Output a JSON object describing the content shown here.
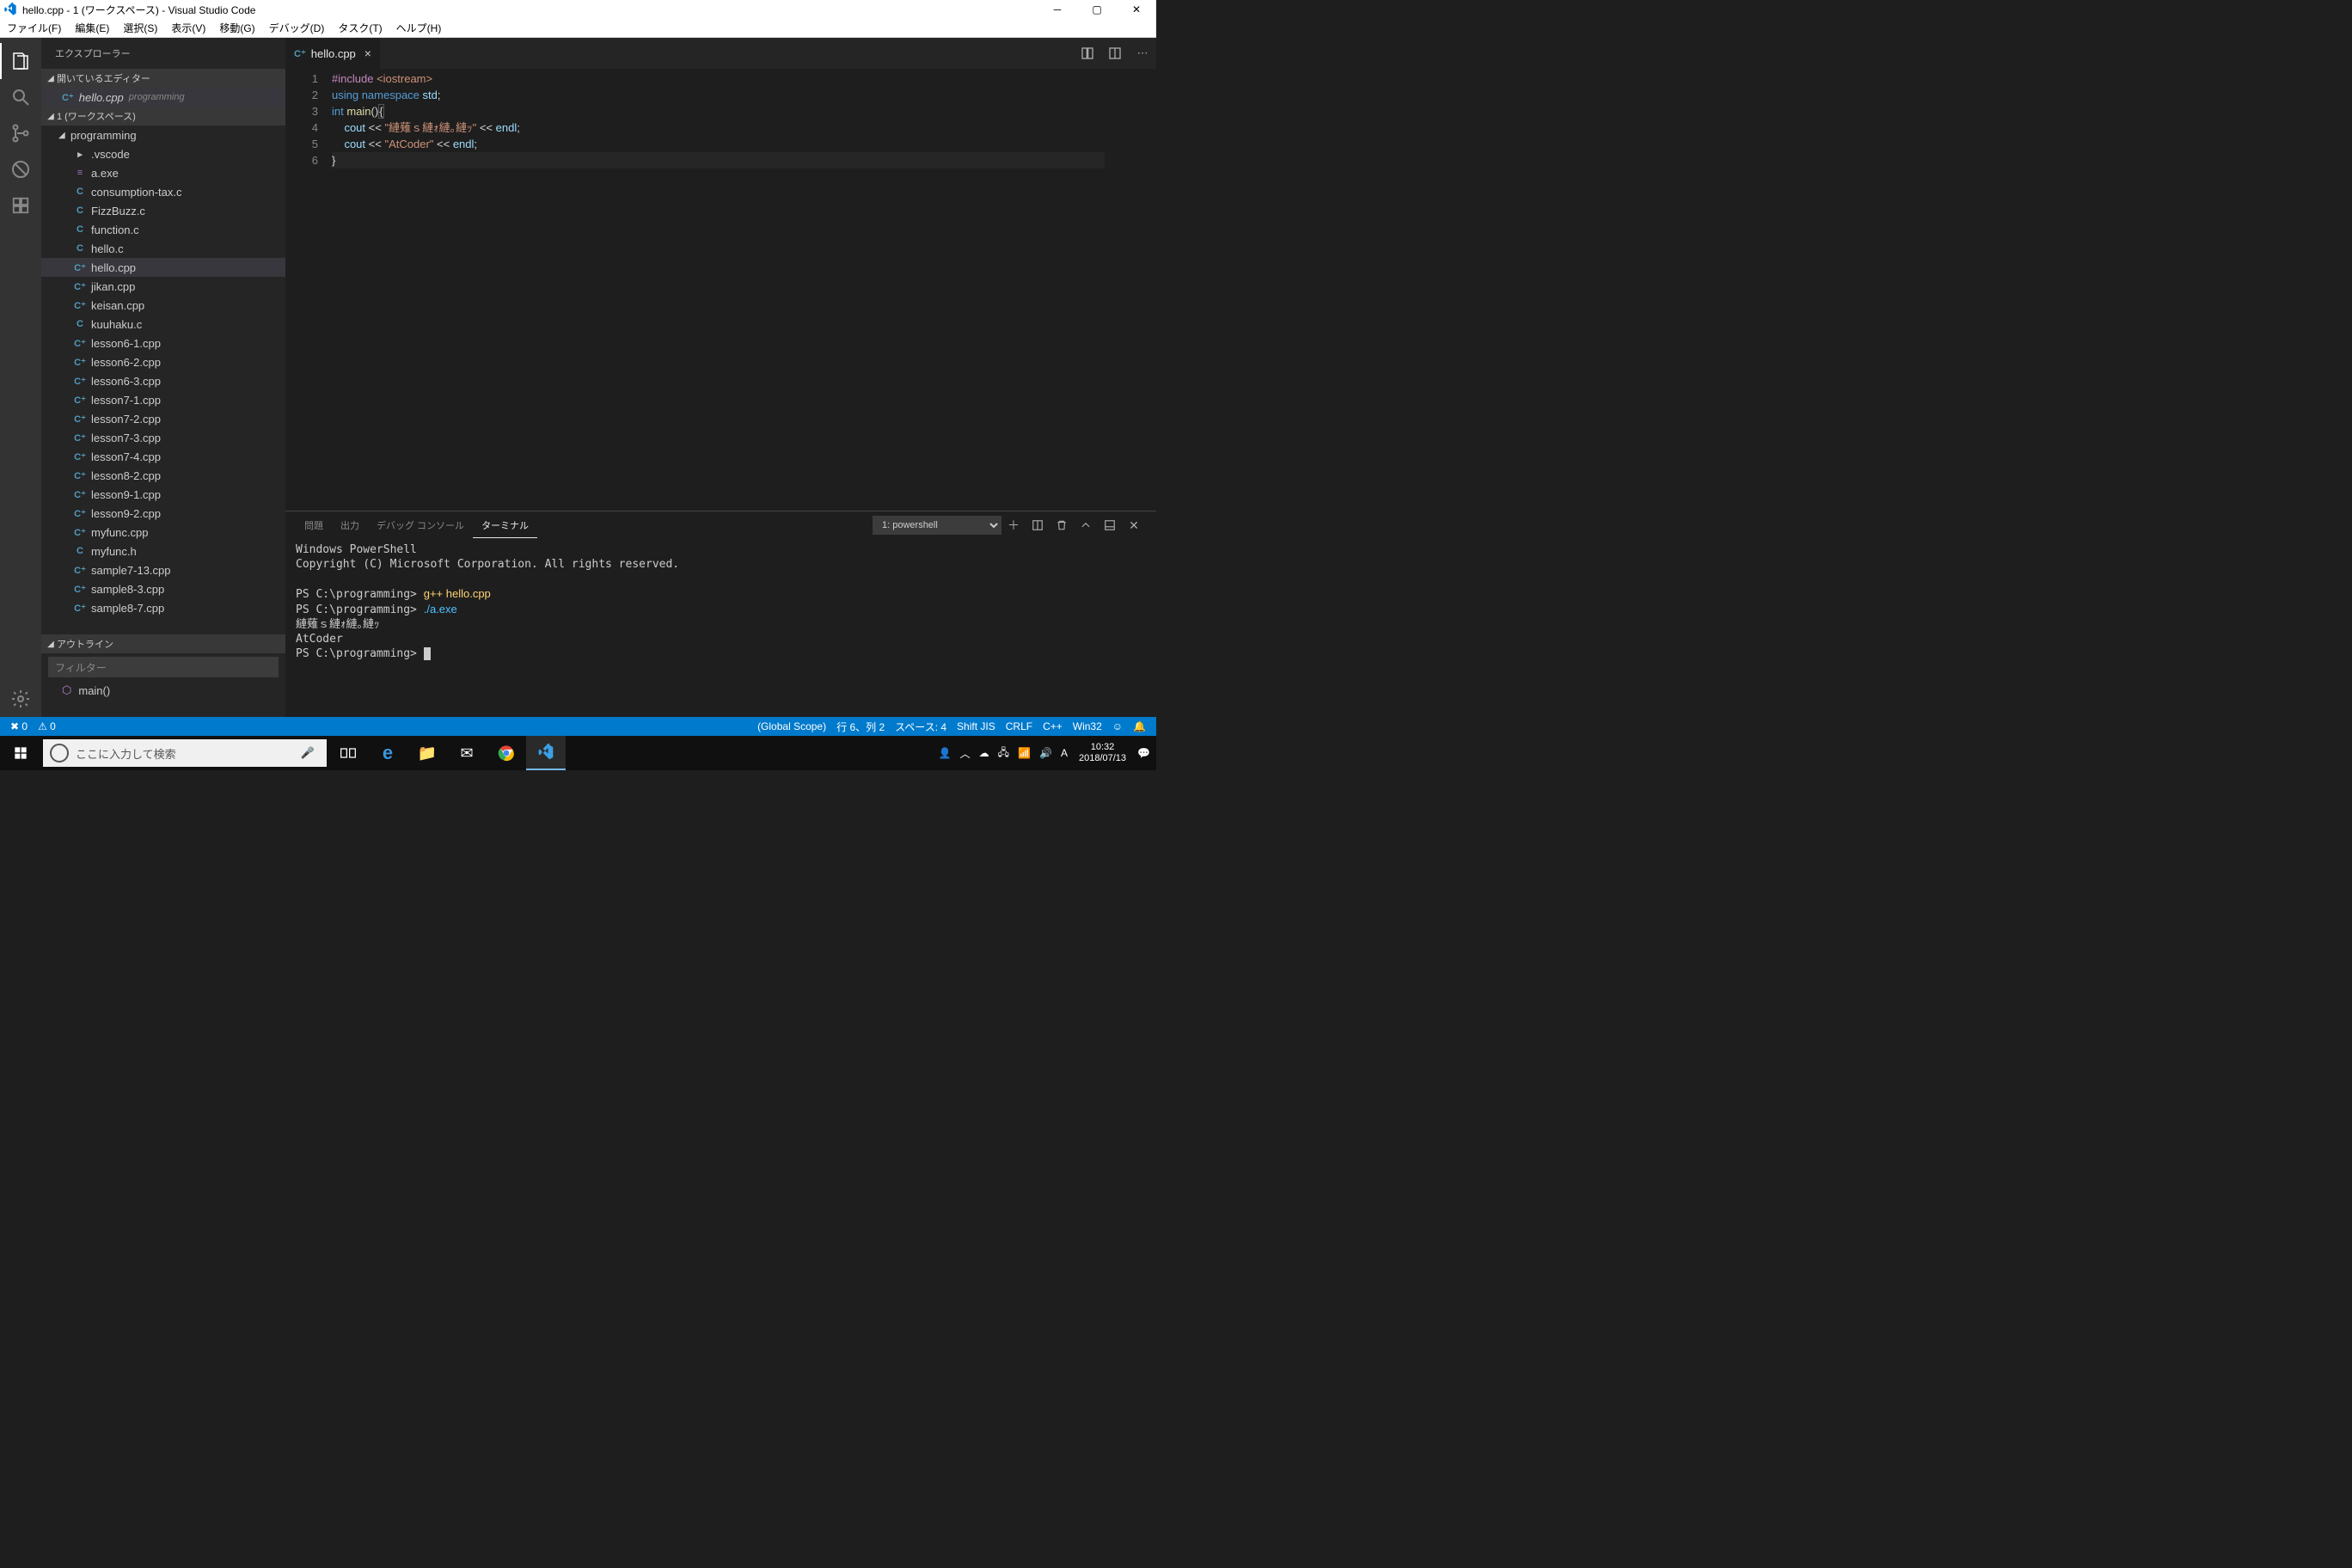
{
  "window": {
    "title": "hello.cpp - 1 (ワークスペース) - Visual Studio Code"
  },
  "menu": [
    "ファイル(F)",
    "編集(E)",
    "選択(S)",
    "表示(V)",
    "移動(G)",
    "デバッグ(D)",
    "タスク(T)",
    "ヘルプ(H)"
  ],
  "sidebar": {
    "title": "エクスプローラー",
    "openEditors": {
      "header": "開いているエディター",
      "items": [
        {
          "name": "hello.cpp",
          "dir": "programming",
          "icon": "C⁺"
        }
      ]
    },
    "workspace": {
      "header": "1 (ワークスペース)",
      "root": "programming",
      "files": [
        {
          "name": ".vscode",
          "icon": "▸",
          "cls": "ico-folder"
        },
        {
          "name": "a.exe",
          "icon": "≡",
          "cls": "ico-exe"
        },
        {
          "name": "consumption-tax.c",
          "icon": "C",
          "cls": "ico-c"
        },
        {
          "name": "FizzBuzz.c",
          "icon": "C",
          "cls": "ico-c"
        },
        {
          "name": "function.c",
          "icon": "C",
          "cls": "ico-c"
        },
        {
          "name": "hello.c",
          "icon": "C",
          "cls": "ico-c"
        },
        {
          "name": "hello.cpp",
          "icon": "C⁺",
          "cls": "ico-cpp",
          "selected": true
        },
        {
          "name": "jikan.cpp",
          "icon": "C⁺",
          "cls": "ico-cpp"
        },
        {
          "name": "keisan.cpp",
          "icon": "C⁺",
          "cls": "ico-cpp"
        },
        {
          "name": "kuuhaku.c",
          "icon": "C",
          "cls": "ico-c"
        },
        {
          "name": "lesson6-1.cpp",
          "icon": "C⁺",
          "cls": "ico-cpp"
        },
        {
          "name": "lesson6-2.cpp",
          "icon": "C⁺",
          "cls": "ico-cpp"
        },
        {
          "name": "lesson6-3.cpp",
          "icon": "C⁺",
          "cls": "ico-cpp"
        },
        {
          "name": "lesson7-1.cpp",
          "icon": "C⁺",
          "cls": "ico-cpp"
        },
        {
          "name": "lesson7-2.cpp",
          "icon": "C⁺",
          "cls": "ico-cpp"
        },
        {
          "name": "lesson7-3.cpp",
          "icon": "C⁺",
          "cls": "ico-cpp"
        },
        {
          "name": "lesson7-4.cpp",
          "icon": "C⁺",
          "cls": "ico-cpp"
        },
        {
          "name": "lesson8-2.cpp",
          "icon": "C⁺",
          "cls": "ico-cpp"
        },
        {
          "name": "lesson9-1.cpp",
          "icon": "C⁺",
          "cls": "ico-cpp"
        },
        {
          "name": "lesson9-2.cpp",
          "icon": "C⁺",
          "cls": "ico-cpp"
        },
        {
          "name": "myfunc.cpp",
          "icon": "C⁺",
          "cls": "ico-cpp"
        },
        {
          "name": "myfunc.h",
          "icon": "C",
          "cls": "ico-c"
        },
        {
          "name": "sample7-13.cpp",
          "icon": "C⁺",
          "cls": "ico-cpp"
        },
        {
          "name": "sample8-3.cpp",
          "icon": "C⁺",
          "cls": "ico-cpp"
        },
        {
          "name": "sample8-7.cpp",
          "icon": "C⁺",
          "cls": "ico-cpp"
        }
      ]
    },
    "outline": {
      "header": "アウトライン",
      "filterPlaceholder": "フィルター",
      "items": [
        {
          "symbol": "⬡",
          "name": "main()"
        }
      ]
    }
  },
  "editor": {
    "tab": {
      "name": "hello.cpp",
      "icon": "C⁺"
    },
    "lines": [
      {
        "n": 1,
        "html": "<span class='tok-macro'>#include</span> <span class='tok-string'>&lt;iostream&gt;</span>"
      },
      {
        "n": 2,
        "html": "<span class='tok-keyword'>using</span> <span class='tok-keyword'>namespace</span> <span class='tok-ident'>std</span><span class='tok-punc'>;</span>"
      },
      {
        "n": 3,
        "html": "<span class='tok-type'>int</span> <span class='tok-func'>main</span><span class='tok-punc'>()</span><span style='border:1px solid #555;'><span class='tok-punc'>{</span></span>"
      },
      {
        "n": 4,
        "html": "    <span class='tok-ident'>cout</span> <span class='tok-punc'>&lt;&lt;</span> <span class='tok-string'>\"縺薙ｓ縺ｫ縺｡縺ｯ\"</span> <span class='tok-punc'>&lt;&lt;</span> <span class='tok-ident'>endl</span><span class='tok-punc'>;</span>"
      },
      {
        "n": 5,
        "html": "    <span class='tok-ident'>cout</span> <span class='tok-punc'>&lt;&lt;</span> <span class='tok-string'>\"AtCoder\"</span> <span class='tok-punc'>&lt;&lt;</span> <span class='tok-ident'>endl</span><span class='tok-punc'>;</span>"
      },
      {
        "n": 6,
        "html": "<span class='current-line'><span class='tok-punc'>}</span></span>"
      }
    ]
  },
  "panel": {
    "tabs": [
      "問題",
      "出力",
      "デバッグ コンソール",
      "ターミナル"
    ],
    "activeTab": 3,
    "terminalSelect": "1: powershell",
    "terminal": [
      {
        "t": "Windows PowerShell"
      },
      {
        "t": "Copyright (C) Microsoft Corporation. All rights reserved."
      },
      {
        "t": ""
      },
      {
        "prompt": "PS C:\\programming> ",
        "cmd": "g++ hello.cpp"
      },
      {
        "prompt": "PS C:\\programming> ",
        "cmd": "./a.exe",
        "cmdcls": "term-exe"
      },
      {
        "t": "縺薙ｓ縺ｫ縺｡縺ｯ"
      },
      {
        "t": "AtCoder"
      },
      {
        "prompt": "PS C:\\programming> ",
        "cursor": true
      }
    ]
  },
  "status": {
    "errors": "✖ 0",
    "warnings": "⚠ 0",
    "scope": "(Global Scope)",
    "pos": "行 6、列 2",
    "spaces": "スペース: 4",
    "encoding": "Shift JIS",
    "eol": "CRLF",
    "lang": "C++",
    "target": "Win32",
    "smile": "☺",
    "bell": "🔔"
  },
  "taskbar": {
    "searchPlaceholder": "ここに入力して検索",
    "clock": {
      "time": "10:32",
      "date": "2018/07/13"
    }
  }
}
